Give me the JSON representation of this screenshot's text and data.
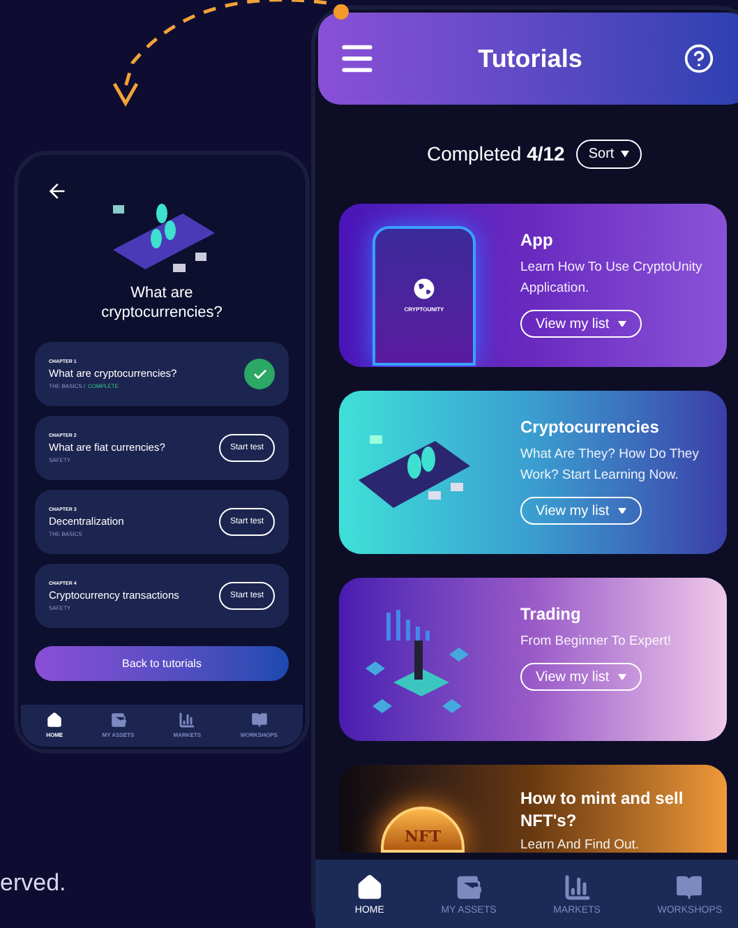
{
  "footer_fragment": "erved.",
  "detail_phone": {
    "title": "What are cryptocurrencies?",
    "chapters": [
      {
        "chapter": "CHAPTER 1",
        "title": "What are cryptocurrencies?",
        "category": "THE BASICS /",
        "status": "COMPLETE",
        "completed": true
      },
      {
        "chapter": "CHAPTER 2",
        "title": "What are fiat currencies?",
        "category": "SAFETY",
        "action": "Start test",
        "completed": false
      },
      {
        "chapter": "CHAPTER 3",
        "title": "Decentralization",
        "category": "THE BASICS",
        "action": "Start test",
        "completed": false
      },
      {
        "chapter": "CHAPTER 4",
        "title": "Cryptocurrency transactions",
        "category": "SAFETY",
        "action": "Start test",
        "completed": false
      }
    ],
    "back_button": "Back to tutorials",
    "nav": [
      {
        "kind": "home",
        "label": "HOME",
        "selected": true
      },
      {
        "kind": "assets",
        "label": "MY ASSETS",
        "selected": false
      },
      {
        "kind": "markets",
        "label": "MARKETS",
        "selected": false
      },
      {
        "kind": "workshops",
        "label": "WORKSHOPS",
        "selected": false
      }
    ]
  },
  "tutorials_phone": {
    "title": "Tutorials",
    "completed_label": "Completed",
    "completed_count": "4/12",
    "sort": "Sort",
    "cards": [
      {
        "kind": "app",
        "title": "App",
        "description": "Learn How To Use CryptoUnity Application.",
        "button": "View my list",
        "art_text": "CRYPTOUNITY"
      },
      {
        "kind": "crypto",
        "title": "Cryptocurrencies",
        "description": "What Are They? How Do They Work? Start Learning Now.",
        "button": "View my list"
      },
      {
        "kind": "trading",
        "title": "Trading",
        "description": "From Beginner To Expert!",
        "button": "View my list"
      },
      {
        "kind": "nft",
        "title": "How to mint and sell NFT's?",
        "description": "Learn And Find Out.",
        "art_text": "NFT"
      }
    ],
    "nav": [
      {
        "kind": "home",
        "label": "HOME",
        "selected": true
      },
      {
        "kind": "assets",
        "label": "MY ASSETS",
        "selected": false
      },
      {
        "kind": "markets",
        "label": "MARKETS",
        "selected": false
      },
      {
        "kind": "workshops",
        "label": "WORKSHOPS",
        "selected": false
      }
    ]
  }
}
